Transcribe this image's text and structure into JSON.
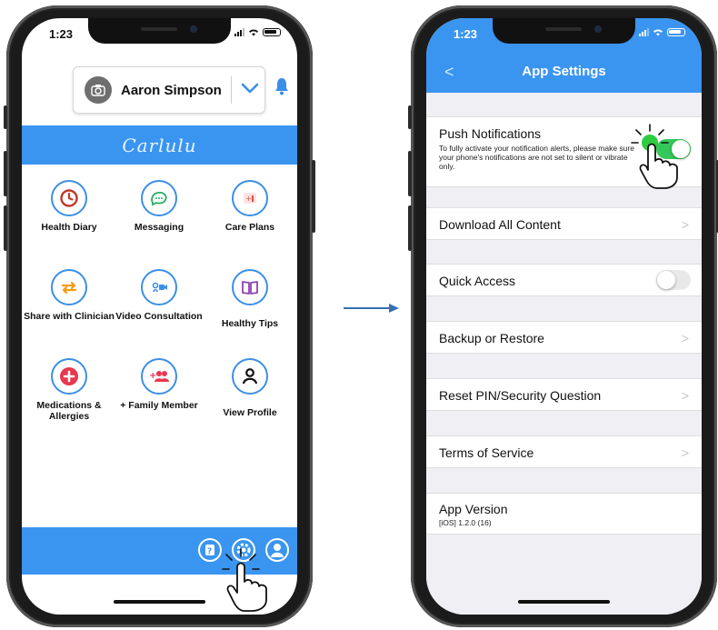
{
  "left_phone": {
    "status_time": "1:23",
    "user_name": "Aaron Simpson",
    "brand_logo": "Carlulu",
    "tiles": [
      {
        "label": "Health Diary",
        "icon": "clock-icon",
        "color": "#c0392b"
      },
      {
        "label": "Messaging",
        "icon": "chat-icon",
        "color": "#27ae60"
      },
      {
        "label": "Care Plans",
        "icon": "care-plan-icon",
        "color": "#e74c3c"
      },
      {
        "label": "Share with Clinician",
        "icon": "share-arrows-icon",
        "color": "#f39c12"
      },
      {
        "label": "Video Consultation",
        "icon": "video-icon",
        "color": "#3b8fe6"
      },
      {
        "label": "Healthy Tips",
        "icon": "book-icon",
        "color": "#8e44ad"
      },
      {
        "label": "Medications & Allergies",
        "icon": "plus-circle-icon",
        "color": "#e53950"
      },
      {
        "label": "+ Family Member",
        "icon": "family-icon",
        "color": "#e53950"
      },
      {
        "label": "View Profile",
        "icon": "profile-icon",
        "color": "#111111"
      }
    ],
    "footer_icons": [
      "help-icon",
      "settings-icon",
      "account-icon"
    ]
  },
  "right_phone": {
    "status_time": "1:23",
    "nav_title": "App Settings",
    "back_label": "<",
    "rows": {
      "push": {
        "title": "Push Notifications",
        "subtitle": "To fully activate your notification alerts, please make sure your phone's notifications are not set to silent or vibrate only.",
        "toggle_on": true
      },
      "download": {
        "title": "Download All Content"
      },
      "quick": {
        "title": "Quick Access",
        "toggle_on": false
      },
      "backup": {
        "title": "Backup or Restore"
      },
      "reset": {
        "title": "Reset PIN/Security Question"
      },
      "terms": {
        "title": "Terms of Service"
      },
      "version": {
        "title": "App Version",
        "subtitle": "[iOS] 1.2.0 (16)"
      }
    },
    "chevron": ">"
  },
  "colors": {
    "brand_blue": "#3a95f0",
    "toggle_on": "#34c759",
    "settings_bg": "#efeff4"
  }
}
